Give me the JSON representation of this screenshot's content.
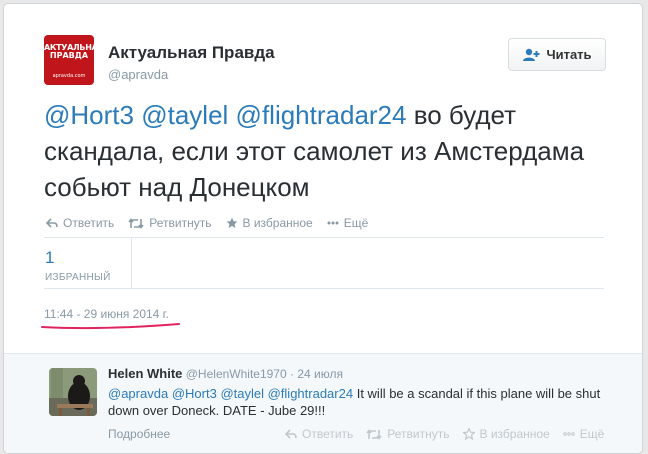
{
  "user": {
    "name": "Актуальная Правда",
    "handle": "@apravda",
    "logo_line1": "АКТУАЛЬНАЯ",
    "logo_line2": "ПРАВДА",
    "logo_line3": "apravda.com"
  },
  "follow_button": {
    "label": "Читать",
    "icon": "add-user-icon"
  },
  "tweet": {
    "mention1": "@Hort3",
    "mention2": "@taylel",
    "mention3": "@flightradar24",
    "text": "во будет скандала, если этот самолет из Амстердама собьют над Донецком"
  },
  "actions": {
    "reply": "Ответить",
    "retweet": "Ретвитнуть",
    "favorite": "В избранное",
    "more": "Ещё"
  },
  "stats": {
    "favorites_count": "1",
    "favorites_label": "ИЗБРАННЫЙ"
  },
  "timestamp": "11:44 - 29 июня 2014 г.",
  "colors": {
    "link": "#2b7bb9",
    "text": "#292f33",
    "muted": "#8899a6",
    "underline": "#e0245e",
    "logo_bg": "#c0151a"
  },
  "reply": {
    "name": "Helen White",
    "handle": "@HelenWhite1970",
    "separator": "·",
    "date": "24 июля",
    "mention1": "@apravda",
    "mention2": "@Hort3",
    "mention3": "@taylel",
    "mention4": "@flightradar24",
    "text": "It will be a scandal if this plane will be shut down over Doneck. DATE - Jube 29!!!",
    "more": "Подробнее",
    "actions": {
      "reply": "Ответить",
      "retweet": "Ретвитнуть",
      "favorite": "В избранное",
      "more": "Ещё"
    }
  }
}
